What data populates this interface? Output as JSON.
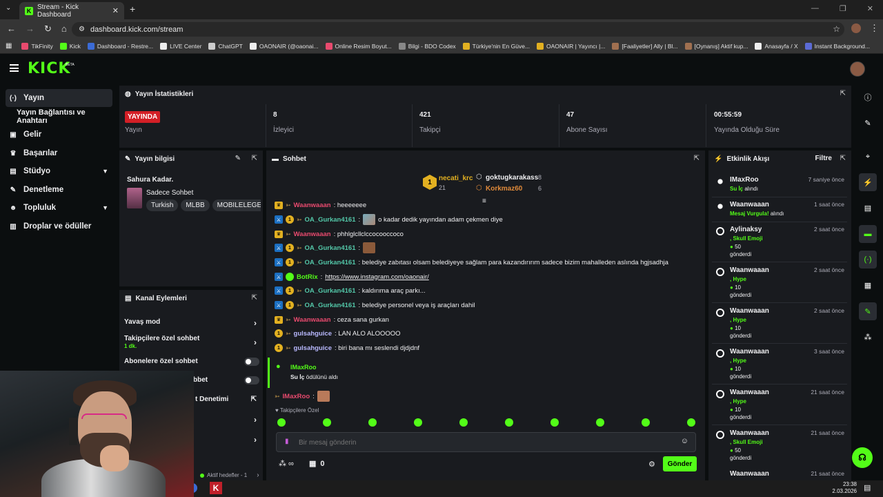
{
  "browser": {
    "tab_title": "Stream - Kick Dashboard",
    "url": "dashboard.kick.com/stream",
    "bookmarks": [
      {
        "label": "TikFinity",
        "color": "#e84a6e"
      },
      {
        "label": "Kick",
        "color": "#53fc18"
      },
      {
        "label": "Dashboard - Restre...",
        "color": "#3b6bd6"
      },
      {
        "label": "LIVE Center",
        "color": "#eeeeee"
      },
      {
        "label": "ChatGPT",
        "color": "#cccccc"
      },
      {
        "label": "OAONAIR (@oaonai...",
        "color": "#eeeeee"
      },
      {
        "label": "Online Resim Boyut...",
        "color": "#e84a6e"
      },
      {
        "label": "Bilgi - BDO Codex",
        "color": "#888888"
      },
      {
        "label": "Türkiye'nin En Güve...",
        "color": "#e2b021"
      },
      {
        "label": "OAONAIR | Yayıncı |...",
        "color": "#e2b021"
      },
      {
        "label": "[Faaliyetler] Ally | Bl...",
        "color": "#a07050"
      },
      {
        "label": "[Oynanış] Aktif kup...",
        "color": "#a07050"
      },
      {
        "label": "Anasayfa / X",
        "color": "#eeeeee"
      },
      {
        "label": "Instant Background...",
        "color": "#5b6bd6"
      }
    ]
  },
  "header": {
    "logo": "KICK",
    "beta": "BETA"
  },
  "sidebar": {
    "items": [
      {
        "label": "Yayın",
        "icon": "broadcast-icon"
      },
      {
        "label": "Yayın Bağlantısı ve Anahtarı"
      },
      {
        "label": "Gelir",
        "icon": "revenue-icon"
      },
      {
        "label": "Başarılar",
        "icon": "trophy-icon"
      },
      {
        "label": "Stüdyo",
        "icon": "studio-icon"
      },
      {
        "label": "Denetleme",
        "icon": "wrench-icon"
      },
      {
        "label": "Topluluk",
        "icon": "people-icon"
      },
      {
        "label": "Droplar ve ödüller",
        "icon": "gift-icon"
      }
    ]
  },
  "stats": {
    "title": "Yayın İstatistikleri",
    "live_badge": "YAYINDA",
    "live_label": "Yayın",
    "items": [
      {
        "value": "8",
        "label": "İzleyici"
      },
      {
        "value": "421",
        "label": "Takipçi"
      },
      {
        "value": "47",
        "label": "Abone Sayısı"
      },
      {
        "value": "00:55:59",
        "label": "Yayında Olduğu Süre"
      }
    ]
  },
  "stream_info": {
    "title": "Yayın bilgisi",
    "stream_title": "Sahura Kadar.",
    "category": "Sadece Sohbet",
    "tags": [
      "Turkish",
      "MLBB",
      "MOBILELEGEN"
    ]
  },
  "channel_actions": {
    "title": "Kanal Eylemleri",
    "items": [
      {
        "label": "Yavaş mod"
      },
      {
        "label": "Takipçilere özel sohbet",
        "sub": "1 dk."
      },
      {
        "label": "Abonelere özel sohbet"
      },
      {
        "label": "bbet"
      },
      {
        "label": "t Denetimi"
      }
    ],
    "active_goals": "Aktif hedefler - 1"
  },
  "chat": {
    "title": "Sohbet",
    "top_gifters": [
      {
        "name": "necati_krc",
        "count": "21",
        "rank": "1"
      },
      {
        "name": "goktugkarakass",
        "count": "8"
      },
      {
        "name": "Korkmaz60",
        "count": "6"
      }
    ],
    "messages": [
      {
        "user": "Waanwaaan",
        "text": ": heeeeeee",
        "style": "red"
      },
      {
        "user": "OA_Gurkan4161",
        "text": "o kadar dedik yayından adam çekmen diye",
        "style": "mod"
      },
      {
        "user": "Waanwaaan",
        "text": ": phhlglcllclccocooccoco",
        "style": "red"
      },
      {
        "user": "OA_Gurkan4161",
        "text": "",
        "style": "mod"
      },
      {
        "user": "OA_Gurkan4161",
        "text": ": belediye zabıtası olsam belediyeye sağlam para kazandırırım sadece bizim mahalleden aslında hgjsadhja",
        "style": "mod"
      },
      {
        "user": "BotRix",
        "text": "https://www.instagram.com/oaonair/",
        "style": "bot"
      },
      {
        "user": "OA_Gurkan4161",
        "text": ": kaldırıma araç parkı...",
        "style": "mod"
      },
      {
        "user": "OA_Gurkan4161",
        "text": ": belediye personel veya iş araçları dahil",
        "style": "mod"
      },
      {
        "user": "Waanwaaan",
        "text": ": ceza sana gurkan",
        "style": "red"
      },
      {
        "user": "gulsahguice",
        "text": ": LAN ALO ALOOOOO",
        "style": "gul"
      },
      {
        "user": "gulsahguice",
        "text": ": biri bana mı seslendi djdjdnf",
        "style": "gul"
      }
    ],
    "reward": {
      "user": "IMaxRoo",
      "text": "Su İç",
      "suffix": " ödülünü aldı"
    },
    "last_user": "IMaxRoo",
    "followers_only": "Takipçilere Özel",
    "input_placeholder": "Bir mesaj gönderin",
    "infinity": "∞",
    "zero": "0",
    "send_label": "Gönder"
  },
  "activity": {
    "title": "Etkinlik Akışı",
    "filter": "Filtre",
    "items": [
      {
        "name": "IMaxRoo",
        "time": "7 saniye önce",
        "line1": "Su İç",
        "line1_suffix": " alındı"
      },
      {
        "name": "Waanwaaan",
        "time": "1 saat önce",
        "line1": "Mesaj Vurgula!",
        "line1_suffix": " alındı"
      },
      {
        "name": "Aylinaksy",
        "time": "2 saat önce",
        "line1": ", Skull Emoji",
        "amount": "50",
        "sent": "gönderdi"
      },
      {
        "name": "Waanwaaan",
        "time": "2 saat önce",
        "line1": ", Hype",
        "amount": "10",
        "sent": "gönderdi"
      },
      {
        "name": "Waanwaaan",
        "time": "2 saat önce",
        "line1": ", Hype",
        "amount": "10",
        "sent": "gönderdi"
      },
      {
        "name": "Waanwaaan",
        "time": "3 saat önce",
        "line1": ", Hype",
        "amount": "10",
        "sent": "gönderdi"
      },
      {
        "name": "Waanwaaan",
        "time": "21 saat önce",
        "line1": ", Hype",
        "amount": "10",
        "sent": "gönderdi"
      },
      {
        "name": "Waanwaaan",
        "time": "21 saat önce",
        "line1": ", Skull Emoji",
        "amount": "50",
        "sent": "gönderdi"
      },
      {
        "name": "Waanwaaan",
        "time": "21 saat önce"
      }
    ]
  },
  "taskbar": {
    "time": "23:38",
    "date": "2.03.2026"
  }
}
